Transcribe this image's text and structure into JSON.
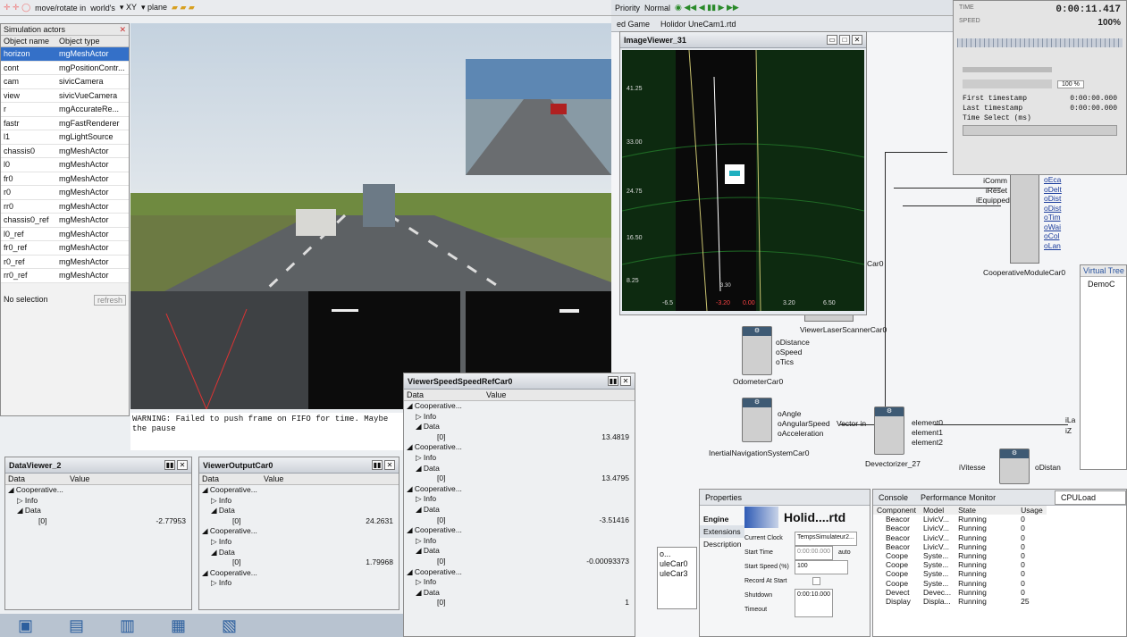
{
  "colors": {
    "scene_sky": "#b9c7d4",
    "road": "#5b5f62",
    "grass": "#6e8a3d",
    "node_header": "#3e5a74",
    "accent": "#2f5bb5"
  },
  "top_toolbar": {
    "move_label": "move/rotate in",
    "frame": "world's",
    "axis": "XY",
    "plane": "plane"
  },
  "simulation_actors": {
    "title": "Simulation actors",
    "col_name": "Object name",
    "col_type": "Object type",
    "status": "No selection",
    "refresh": "refresh",
    "rows": [
      [
        "horizon",
        "mgMeshActor"
      ],
      [
        "cont",
        "mgPositionContr..."
      ],
      [
        "cam",
        "sivicCamera"
      ],
      [
        "view",
        "sivicVueCamera"
      ],
      [
        "r",
        "mgAccurateRe..."
      ],
      [
        "fastr",
        "mgFastRenderer"
      ],
      [
        "l1",
        "mgLightSource"
      ],
      [
        "chassis0",
        "mgMeshActor"
      ],
      [
        "l0",
        "mgMeshActor"
      ],
      [
        "fr0",
        "mgMeshActor"
      ],
      [
        "r0",
        "mgMeshActor"
      ],
      [
        "rr0",
        "mgMeshActor"
      ],
      [
        "chassis0_ref",
        "mgMeshActor"
      ],
      [
        "l0_ref",
        "mgMeshActor"
      ],
      [
        "fr0_ref",
        "mgMeshActor"
      ],
      [
        "r0_ref",
        "mgMeshActor"
      ],
      [
        "rr0_ref",
        "mgMeshActor"
      ]
    ]
  },
  "warning": "WARNING: Failed to push frame on FIFO for time. Maybe the pause",
  "image_viewer": {
    "title": "ImageViewer_31",
    "ylabels": [
      "41.25",
      "33.00",
      "24.75",
      "16.50",
      "8.25"
    ],
    "xlabels": [
      "-6.5",
      "-3.20",
      "0.00",
      "3.20",
      "6.50"
    ],
    "near": "3.30"
  },
  "engine_bar": {
    "priority_label": "Priority",
    "priority": "Normal",
    "tab1": "ed Game",
    "tab2": "Holidor UneCam1.rtd"
  },
  "time_panel": {
    "time_label": "TIME",
    "time": "0:00:11.417",
    "speed_label": "SPEED",
    "speed": "100%",
    "first": "First timestamp",
    "first_val": "0:00:00.000",
    "last": "Last timestamp",
    "last_val": "0:00:00.000",
    "select": "Time Select (ms)",
    "zoom": "100 %"
  },
  "diagram": {
    "odo": "OdometerCar0",
    "odo_ports": [
      "oDistance",
      "oSpeed",
      "oTics"
    ],
    "ins": "InertialNavigationSystemCar0",
    "ins_ports": [
      "oAngle",
      "oAngularSpeed",
      "oAcceleration"
    ],
    "vector_in": "Vector in",
    "devect": "Devectorizer_27",
    "devect_ports": [
      "element0",
      "element1",
      "element2"
    ],
    "laser": "ViewerLaserScannerCar0",
    "coop": "CooperativeModuleCar0",
    "coop_in": [
      "iComm",
      "iReset",
      "iEquipped"
    ],
    "coop_out": [
      "oEca",
      "oDelt",
      "oDist",
      "oDist",
      "oTim",
      "oWai",
      "oCol",
      "oLan"
    ],
    "car0": "Car0",
    "ivitesse": "iVitesse",
    "odistan": "oDistan",
    "il": "iLa",
    "iz": "iZ"
  },
  "virtual_tree": {
    "label": "Virtual Tree",
    "item": "DemoC"
  },
  "data_viewer": {
    "title": "DataViewer_2",
    "col_data": "Data",
    "col_value": "Value",
    "rows": [
      [
        "Cooperative...",
        ""
      ],
      [
        "Info",
        ""
      ],
      [
        "Data",
        ""
      ],
      [
        "[0]",
        "-2.77953"
      ]
    ]
  },
  "output_viewer": {
    "title": "ViewerOutputCar0",
    "col_data": "Data",
    "col_value": "Value",
    "rows": [
      [
        "Cooperative...",
        ""
      ],
      [
        "Info",
        ""
      ],
      [
        "Data",
        ""
      ],
      [
        "[0]",
        "24.2631"
      ],
      [
        "Cooperative...",
        ""
      ],
      [
        "Info",
        ""
      ],
      [
        "Data",
        ""
      ],
      [
        "[0]",
        "1.79968"
      ],
      [
        "Cooperative...",
        ""
      ],
      [
        "Info",
        ""
      ]
    ]
  },
  "speed_viewer": {
    "title": "ViewerSpeedSpeedRefCar0",
    "col_data": "Data",
    "col_value": "Value",
    "rows": [
      [
        "Cooperative...",
        ""
      ],
      [
        "Info",
        ""
      ],
      [
        "Data",
        ""
      ],
      [
        "[0]",
        "13.4819"
      ],
      [
        "Cooperative...",
        ""
      ],
      [
        "Info",
        ""
      ],
      [
        "Data",
        ""
      ],
      [
        "[0]",
        "13.4795"
      ],
      [
        "Cooperative...",
        ""
      ],
      [
        "Info",
        ""
      ],
      [
        "Data",
        ""
      ],
      [
        "[0]",
        "-3.51416"
      ],
      [
        "Cooperative...",
        ""
      ],
      [
        "Info",
        ""
      ],
      [
        "Data",
        ""
      ],
      [
        "[0]",
        "-0.00093373"
      ],
      [
        "Cooperative...",
        ""
      ],
      [
        "Info",
        ""
      ],
      [
        "Data",
        ""
      ],
      [
        "[0]",
        "1"
      ]
    ]
  },
  "side_list": {
    "items": [
      "o...",
      "uleCar0",
      "uleCar3"
    ]
  },
  "properties": {
    "tab": "Properties",
    "title": "Holid....rtd",
    "side_tabs": [
      "Engine",
      "Extensions",
      "Description"
    ],
    "clock_label": "Current Clock",
    "clock": "TempsSimulateur2...",
    "start_label": "Start Time",
    "start": "0:00:00.000",
    "auto": "auto",
    "speed_label": "Start Speed (%)",
    "speed": "100",
    "record_label": "Record At Start",
    "shutdown_label": "Shutdown Timeout",
    "shutdown": "0:00:10.000"
  },
  "perf": {
    "tab_console": "Console",
    "tab_perf": "Performance Monitor",
    "select": "CPULoad",
    "cols": [
      "Component",
      "Model",
      "State",
      "Usage"
    ],
    "rows": [
      [
        "Beacor",
        "LivicV...",
        "Running",
        "0"
      ],
      [
        "Beacor",
        "LivicV...",
        "Running",
        "0"
      ],
      [
        "Beacor",
        "LivicV...",
        "Running",
        "0"
      ],
      [
        "Beacor",
        "LivicV...",
        "Running",
        "0"
      ],
      [
        "Coope",
        "Syste...",
        "Running",
        "0"
      ],
      [
        "Coope",
        "Syste...",
        "Running",
        "0"
      ],
      [
        "Coope",
        "Syste...",
        "Running",
        "0"
      ],
      [
        "Coope",
        "Syste...",
        "Running",
        "0"
      ],
      [
        "Devect",
        "Devec...",
        "Running",
        "0"
      ],
      [
        "Display",
        "Displa...",
        "Running",
        "25"
      ]
    ]
  }
}
